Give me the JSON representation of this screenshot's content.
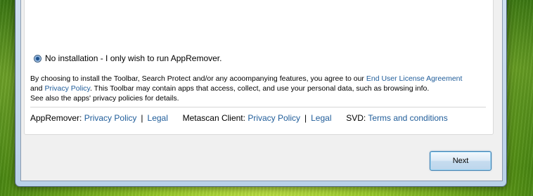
{
  "install_option": {
    "label": "No installation - I only wish to run AppRemover.",
    "selected": true
  },
  "legal_text": {
    "line1_prefix": "By choosing to install the Toolbar, Search Protect and/or any acoompanying features, you agree to our ",
    "eula_link": "End User License Agreement",
    "line2_prefix": "and ",
    "privacy_link": "Privacy Policy",
    "line2_suffix": ". This Toolbar may contain apps that access, collect, and use your personal data, such as browsing info.",
    "line3": "See also the apps' privacy policies for details."
  },
  "footer": {
    "appremover_label": "AppRemover:",
    "appremover_privacy": "Privacy Policy",
    "separator": "|",
    "appremover_legal": "Legal",
    "metascan_label": "Metascan Client:",
    "metascan_privacy": "Privacy Policy",
    "metascan_legal": "Legal",
    "svd_label": "SVD:",
    "svd_terms": "Terms and conditions"
  },
  "buttons": {
    "next_label": "Next"
  }
}
